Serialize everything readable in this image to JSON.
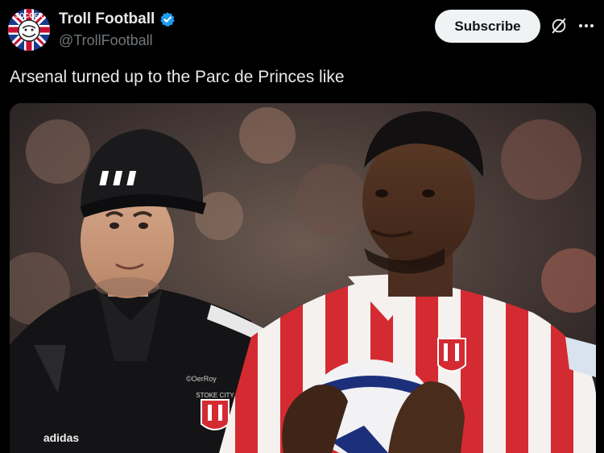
{
  "account": {
    "display_name": "Troll Football",
    "handle": "@TrollFootball",
    "verified": true,
    "avatar_text_top": "SOCCER"
  },
  "actions": {
    "subscribe_label": "Subscribe",
    "grok_icon": "grok-icon",
    "more_icon": "more-icon"
  },
  "tweet": {
    "text": "Arsenal turned up to the Parc de Princes like"
  },
  "media": {
    "type": "photo",
    "shirt_badge_text": "STOKE CITY",
    "jacket_tag": "©OerRoy",
    "brand_text": "adidas"
  },
  "colors": {
    "background": "#000000",
    "text": "#e7e9ea",
    "muted": "#71767b",
    "verified": "#1d9bf0",
    "button_bg": "#eff3f4"
  }
}
